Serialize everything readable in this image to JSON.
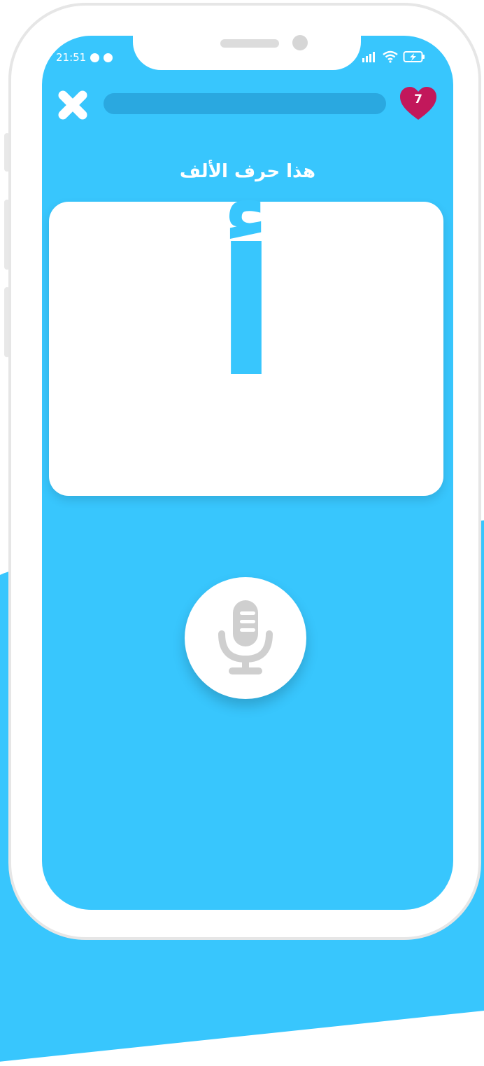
{
  "status_bar": {
    "time": "21:51",
    "icons": [
      "notification-icon",
      "notification-icon",
      "signal-icon",
      "wifi-icon",
      "battery-charging-icon"
    ]
  },
  "top_bar": {
    "close_icon": "close-x-icon",
    "progress": 0,
    "lives_icon": "heart-icon",
    "lives_count": "7"
  },
  "lesson": {
    "prompt": "هذا حرف الألف",
    "letter": "أ"
  },
  "mic": {
    "icon": "microphone-icon"
  },
  "colors": {
    "screen_bg": "#38c6fd",
    "letter": "#38c6fd",
    "heart": "#c2185b",
    "progress_track": "#2aa8e0",
    "mic_icon": "#cfcfcf"
  }
}
